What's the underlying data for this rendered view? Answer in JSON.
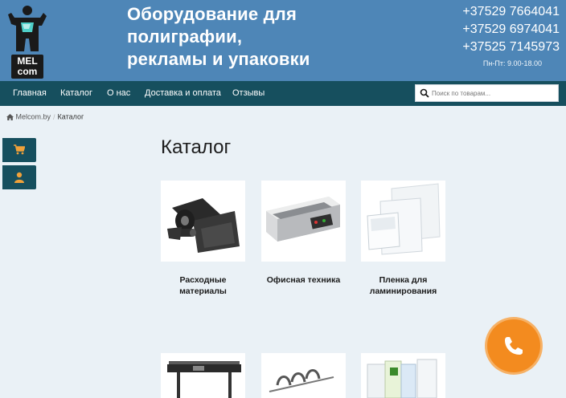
{
  "header": {
    "logo": {
      "line1": "MEL",
      "line2": "com"
    },
    "headline": [
      "Оборудование для",
      "полиграфии,",
      "рекламы и упаковки"
    ],
    "phones": [
      "+37529 7664041",
      "+37529 6974041",
      "+37525 7145973"
    ],
    "hours": "Пн-Пт: 9.00-18.00"
  },
  "nav": {
    "items": [
      "Главная",
      "Каталог",
      "О нас",
      "Доставка и оплата",
      "Отзывы"
    ],
    "search_placeholder": "Поиск по товарам..."
  },
  "breadcrumb": {
    "home": "Melcom.by",
    "sep": "/",
    "current": "Каталог"
  },
  "side": {
    "cart_icon": "cart-icon",
    "user_icon": "user-icon"
  },
  "main": {
    "title": "Каталог",
    "categories": [
      {
        "label_lines": [
          "Расходные",
          "материалы"
        ]
      },
      {
        "label_lines": [
          "Офисная техника"
        ]
      },
      {
        "label_lines": [
          "Пленка для",
          "ламинирования"
        ]
      }
    ]
  },
  "colors": {
    "header_bg": "#4e86b7",
    "nav_bg": "#164f5e",
    "page_bg": "#eaf1f6",
    "call_accent": "#f38b1f"
  }
}
